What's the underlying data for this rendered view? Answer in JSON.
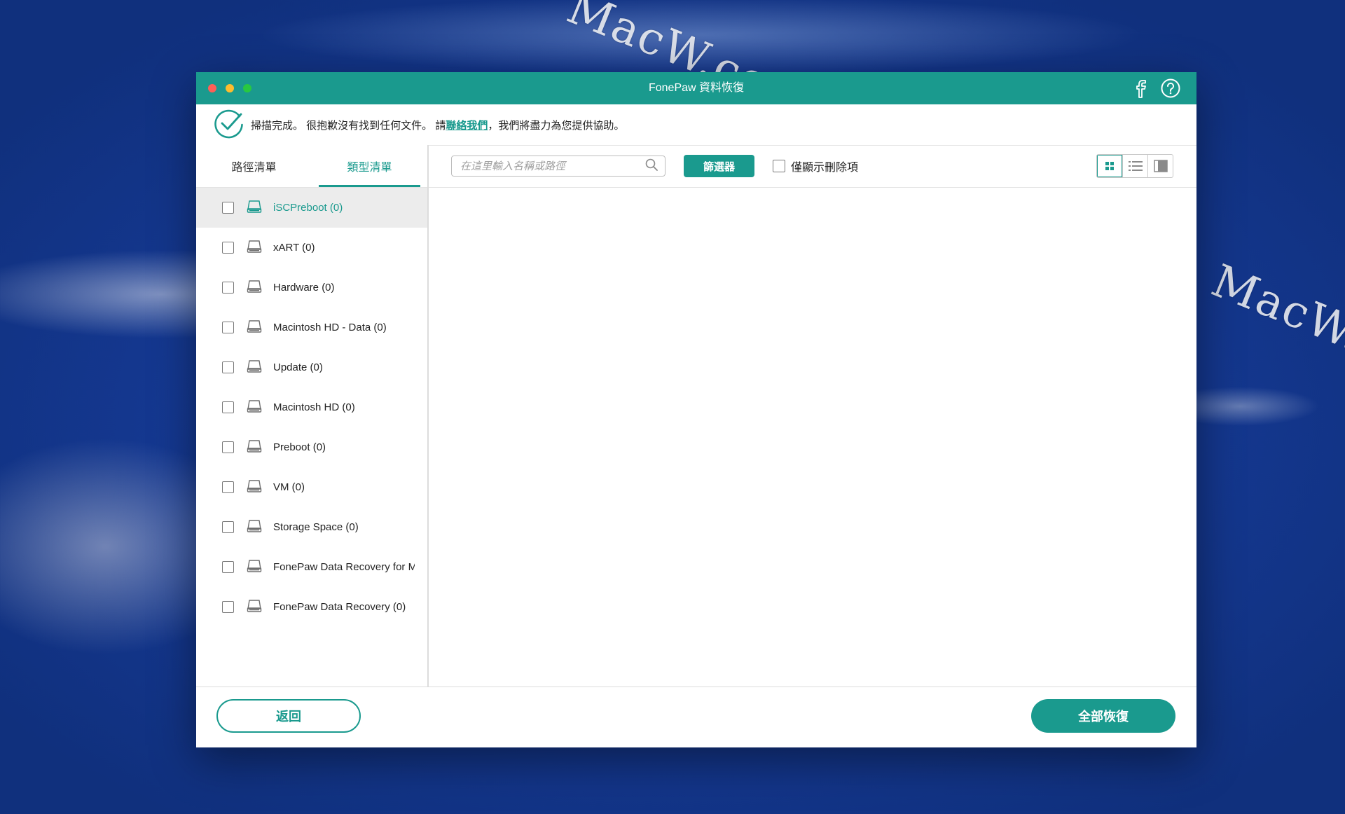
{
  "window": {
    "title": "FonePaw 資料恢復"
  },
  "watermark": {
    "text": "MacW.com"
  },
  "notice": {
    "prefix": "掃描完成。 很抱歉沒有找到任何文件。 請",
    "link": "聯絡我們",
    "suffix": "，我們將盡力為您提供協助。"
  },
  "sidebar": {
    "tabs": [
      {
        "label": "路徑清單",
        "active": false
      },
      {
        "label": "類型清單",
        "active": true
      }
    ],
    "volumes": [
      {
        "label": "iSCPreboot (0)",
        "checked": false,
        "selected": true
      },
      {
        "label": "xART (0)",
        "checked": false,
        "selected": false
      },
      {
        "label": "Hardware (0)",
        "checked": false,
        "selected": false
      },
      {
        "label": "Macintosh HD - Data (0)",
        "checked": false,
        "selected": false
      },
      {
        "label": "Update (0)",
        "checked": false,
        "selected": false
      },
      {
        "label": "Macintosh HD (0)",
        "checked": false,
        "selected": false
      },
      {
        "label": "Preboot (0)",
        "checked": false,
        "selected": false
      },
      {
        "label": "VM (0)",
        "checked": false,
        "selected": false
      },
      {
        "label": "Storage Space (0)",
        "checked": false,
        "selected": false
      },
      {
        "label": "FonePaw Data Recovery for M",
        "checked": false,
        "selected": false
      },
      {
        "label": "FonePaw Data Recovery (0)",
        "checked": false,
        "selected": false
      }
    ]
  },
  "toolbar": {
    "search_placeholder": "在這里輸入名稱或路徑",
    "filter_label": "篩選器",
    "deleted_only_label": "僅顯示刪除項",
    "deleted_only_checked": false,
    "view_modes": [
      "grid-view-icon",
      "list-view-icon",
      "column-view-icon"
    ],
    "active_view": "grid-view-icon"
  },
  "footer": {
    "back_label": "返回",
    "recover_all_label": "全部恢復"
  },
  "colors": {
    "accent": "#1a9a8e",
    "selected_row": "#ececec"
  }
}
